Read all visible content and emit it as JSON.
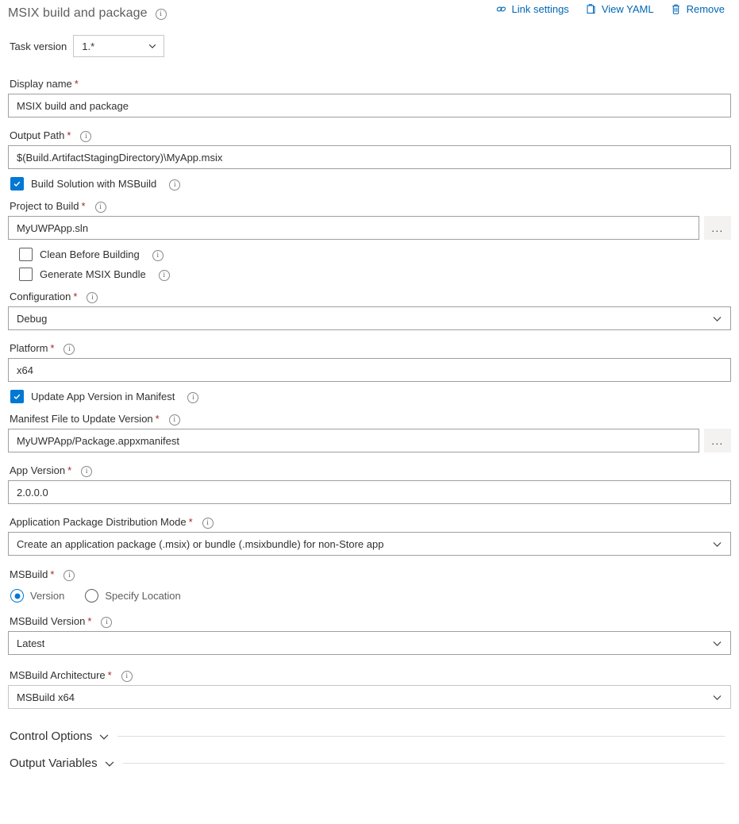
{
  "header": {
    "title": "MSIX build and package",
    "info_icon": "info-icon",
    "actions": [
      {
        "label": "Link settings",
        "icon": "link-icon"
      },
      {
        "label": "View YAML",
        "icon": "clipboard-icon"
      },
      {
        "label": "Remove",
        "icon": "trash-icon"
      }
    ]
  },
  "task_version": {
    "label": "Task version",
    "value": "1.*",
    "chevron": "chevron-down-icon"
  },
  "fields": {
    "display_name": {
      "label": "Display name",
      "required": "*",
      "value": "MSIX build and package"
    },
    "output_path": {
      "label": "Output Path",
      "required": "*",
      "value": "$(Build.ArtifactStagingDirectory)\\MyApp.msix"
    },
    "build_solution": {
      "label": "Build Solution with MSBuild",
      "checked": true
    },
    "project_to_build": {
      "label": "Project to Build",
      "required": "*",
      "value": "MyUWPApp.sln",
      "browse": "..."
    },
    "clean_before_building": {
      "label": "Clean Before Building",
      "checked": false
    },
    "generate_msix_bundle": {
      "label": "Generate MSIX Bundle",
      "checked": false
    },
    "configuration": {
      "label": "Configuration",
      "required": "*",
      "value": "Debug"
    },
    "platform": {
      "label": "Platform",
      "required": "*",
      "value": "x64"
    },
    "update_app_version": {
      "label": "Update App Version in Manifest",
      "checked": true
    },
    "manifest_file": {
      "label": "Manifest File to Update Version",
      "required": "*",
      "value": "MyUWPApp/Package.appxmanifest",
      "browse": "..."
    },
    "app_version": {
      "label": "App Version",
      "required": "*",
      "value": "2.0.0.0"
    },
    "distribution_mode": {
      "label": "Application Package Distribution Mode",
      "required": "*",
      "value": "Create an application package (.msix) or bundle (.msixbundle) for non-Store app"
    },
    "msbuild": {
      "label": "MSBuild",
      "required": "*",
      "option_version": "Version",
      "option_specify_location": "Specify Location",
      "selected": "Version"
    },
    "msbuild_version": {
      "label": "MSBuild Version",
      "required": "*",
      "value": "Latest"
    },
    "msbuild_architecture": {
      "label": "MSBuild Architecture",
      "required": "*",
      "value": "MSBuild x64"
    }
  },
  "sections": [
    {
      "label": "Control Options",
      "chevron": "chevron-down-icon"
    },
    {
      "label": "Output Variables",
      "chevron": "chevron-down-icon"
    }
  ],
  "colors": {
    "accent": "#0078d4",
    "link": "#0066b4",
    "required": "#a4262c",
    "border": "#a19f9d",
    "title": "#605e5c"
  }
}
